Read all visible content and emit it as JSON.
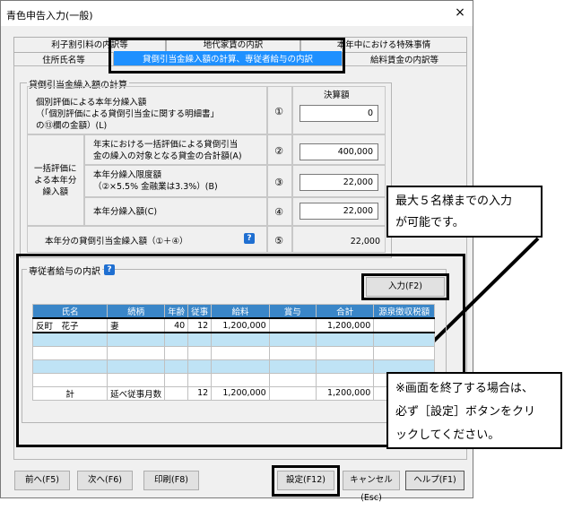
{
  "window": {
    "title": "青色申告入力(一般)",
    "close_label": "×"
  },
  "tabs": {
    "back_row": [
      "利子割引料の内訳等",
      "地代家賃の内訳",
      "本年中における特殊事情"
    ],
    "front_row": [
      "住所氏名等",
      "貸倒引当金繰入額の計算、専従者給与の内訳",
      "給料賃金の内訳等"
    ],
    "active": "貸倒引当金繰入額の計算、専従者給与の内訳"
  },
  "allowance": {
    "group_label": "貸倒引当金繰入額の計算",
    "col_header": "決算額",
    "row1_label": "個別評価による本年分繰入額\n（「個別評価による貸倒引当金に関する明細書」\nの⑬欄の金額）(L)",
    "row1_num": "①",
    "row1_value": "0",
    "batch_label": "一括評価に\nよる本年分\n繰入額",
    "row2_label": "年末における一括評価による貸倒引当\n金の繰入の対象となる貸金の合計額(A)",
    "row2_num": "②",
    "row2_value": "400,000",
    "row3_label": "本年分繰入限度額\n（②×5.5% 金融業は3.3%）(B)",
    "row3_num": "③",
    "row3_value": "22,000",
    "row4_label": "本年分繰入額(C)",
    "row4_num": "④",
    "row4_value": "22,000",
    "row5_label": "本年分の貸倒引当金繰入額（①＋④）",
    "row5_num": "⑤",
    "row5_value": "22,000"
  },
  "salary": {
    "group_label": "専従者給与の内訳",
    "input_button": "入力(F2)",
    "columns": [
      "氏名",
      "続柄",
      "年齢",
      "従事",
      "給料",
      "賞与",
      "合計",
      "源泉徴収税額"
    ],
    "rows": [
      [
        "反町　花子",
        "妻",
        "40",
        "12",
        "1,200,000",
        "",
        "1,200,000",
        ""
      ],
      [
        "",
        "",
        "",
        "",
        "",
        "",
        "",
        ""
      ],
      [
        "",
        "",
        "",
        "",
        "",
        "",
        "",
        ""
      ],
      [
        "",
        "",
        "",
        "",
        "",
        "",
        "",
        ""
      ],
      [
        "",
        "",
        "",
        "",
        "",
        "",
        "",
        ""
      ]
    ],
    "total_row": [
      "計",
      "延べ従事月数",
      "12",
      "1,200,000",
      "",
      "1,200,000",
      ""
    ]
  },
  "buttons": {
    "prev": "前へ(F5)",
    "next": "次へ(F6)",
    "print": "印刷(F8)",
    "settings": "設定(F12)",
    "cancel": "キャンセル(Esc)",
    "help": "ヘルプ(F1)"
  },
  "callouts": {
    "max_five": "最大５名様までの入力\nが可能です。",
    "exit_note": "※画面を終了する場合は、\n必ず［設定］ボタンをクリ\nックしてください。"
  },
  "help_icon": "?",
  "colors": {
    "active_tab": "#1e90ff",
    "grid_header": "#3a86c8",
    "row_blue": "#bfe3f5",
    "help_badge": "#1f6fd1"
  }
}
